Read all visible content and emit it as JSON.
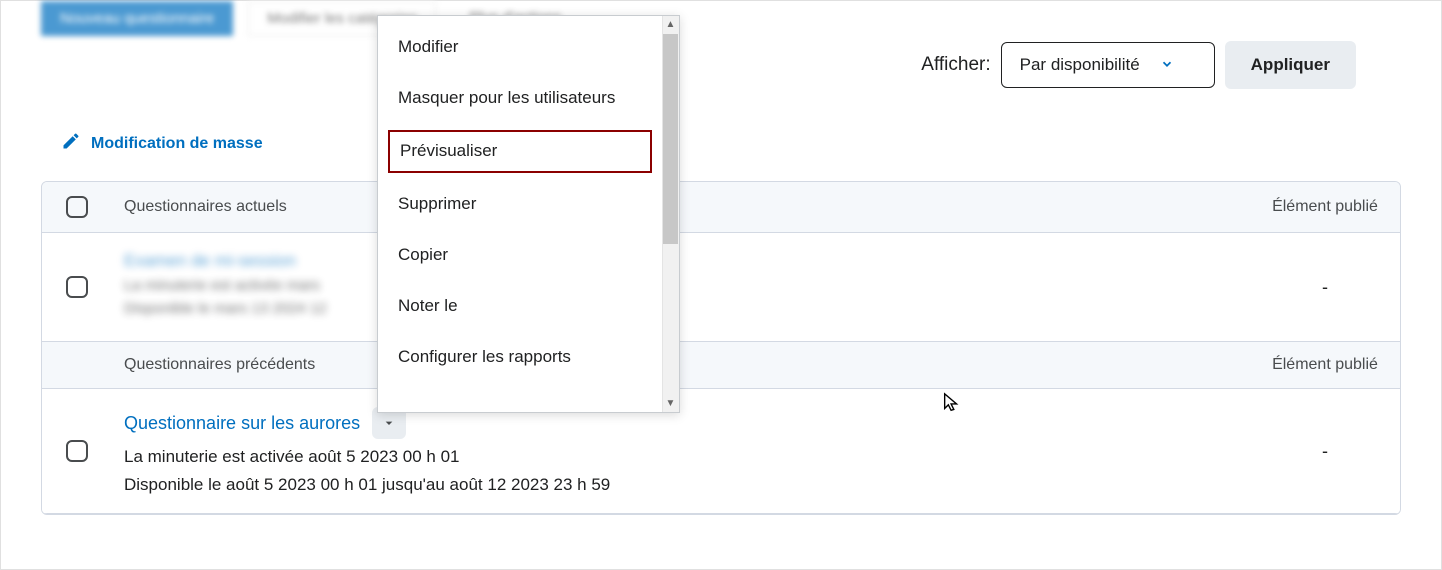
{
  "tabs": {
    "primary": "Nouveau questionnaire",
    "secondary": "Modifier les catégories",
    "more": "Plus d'actions"
  },
  "filter": {
    "label": "Afficher:",
    "selected": "Par disponibilité",
    "apply": "Appliquer"
  },
  "bulk_edit": "Modification de masse",
  "columns": {
    "current": "Questionnaires actuels",
    "previous": "Questionnaires précédents",
    "published": "Élément publié"
  },
  "menu": {
    "items": [
      "Modifier",
      "Masquer pour les utilisateurs",
      "Prévisualiser",
      "Supprimer",
      "Copier",
      "Noter le",
      "Configurer les rapports"
    ]
  },
  "row1": {
    "title": "Examen de mi-session",
    "line1": "La minuterie est activée mars",
    "line2": "Disponible le mars 13 2024 12",
    "published": "-"
  },
  "row2": {
    "title": "Questionnaire sur les aurores",
    "line1": "La minuterie est activée août 5 2023 00 h 01",
    "line2": "Disponible le août 5 2023 00 h 01 jusqu'au août 12 2023 23 h 59",
    "published": "-"
  }
}
